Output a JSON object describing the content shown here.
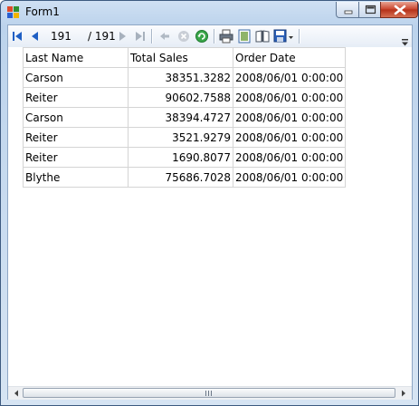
{
  "window": {
    "title": "Form1"
  },
  "toolbar": {
    "current_page": "191",
    "page_of": "/ 191",
    "icons": [
      "first-page-icon",
      "previous-page-icon",
      "next-page-icon",
      "last-page-icon",
      "back-icon",
      "stop-icon",
      "refresh-icon",
      "print-icon",
      "print-layout-icon",
      "page-setup-icon",
      "export-icon"
    ]
  },
  "report": {
    "columns": [
      "Last Name",
      "Total Sales",
      "Order Date"
    ],
    "rows": [
      [
        "Carson",
        "38351.3282",
        "2008/06/01 0:00:00"
      ],
      [
        "Reiter",
        "90602.7588",
        "2008/06/01 0:00:00"
      ],
      [
        "Carson",
        "38394.4727",
        "2008/06/01 0:00:00"
      ],
      [
        "Reiter",
        "3521.9279",
        "2008/06/01 0:00:00"
      ],
      [
        "Reiter",
        "1690.8077",
        "2008/06/01 0:00:00"
      ],
      [
        "Blythe",
        "75686.7028",
        "2008/06/01 0:00:00"
      ]
    ]
  },
  "colors": {
    "accent": "#1f5fc4",
    "grid_border": "#d4d4d4",
    "close_button": "#c8412a"
  }
}
